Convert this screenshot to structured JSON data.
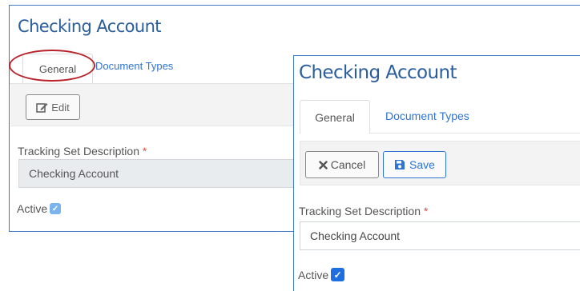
{
  "back_panel": {
    "title": "Checking Account",
    "tabs": {
      "general": "General",
      "document_types": "Document Types"
    },
    "toolbar": {
      "edit_label": "Edit"
    },
    "description": {
      "label": "Tracking Set Description",
      "required_mark": "*",
      "value": "Checking Account"
    },
    "active": {
      "label": "Active",
      "checked": true
    }
  },
  "front_panel": {
    "title": "Checking Account",
    "tabs": {
      "general": "General",
      "document_types": "Document Types"
    },
    "toolbar": {
      "cancel_label": "Cancel",
      "save_label": "Save"
    },
    "description": {
      "label": "Tracking Set Description",
      "required_mark": "*",
      "value": "Checking Account"
    },
    "active": {
      "label": "Active",
      "checked": true
    }
  },
  "colors": {
    "panel_border": "#3d7bc7",
    "title": "#2a5d9c",
    "link": "#2f74d0",
    "annotation": "#b8222a",
    "required": "#d9534f"
  },
  "icons": {
    "edit": "edit-icon",
    "cancel": "close-icon",
    "save": "save-icon",
    "checkbox": "check-icon"
  }
}
